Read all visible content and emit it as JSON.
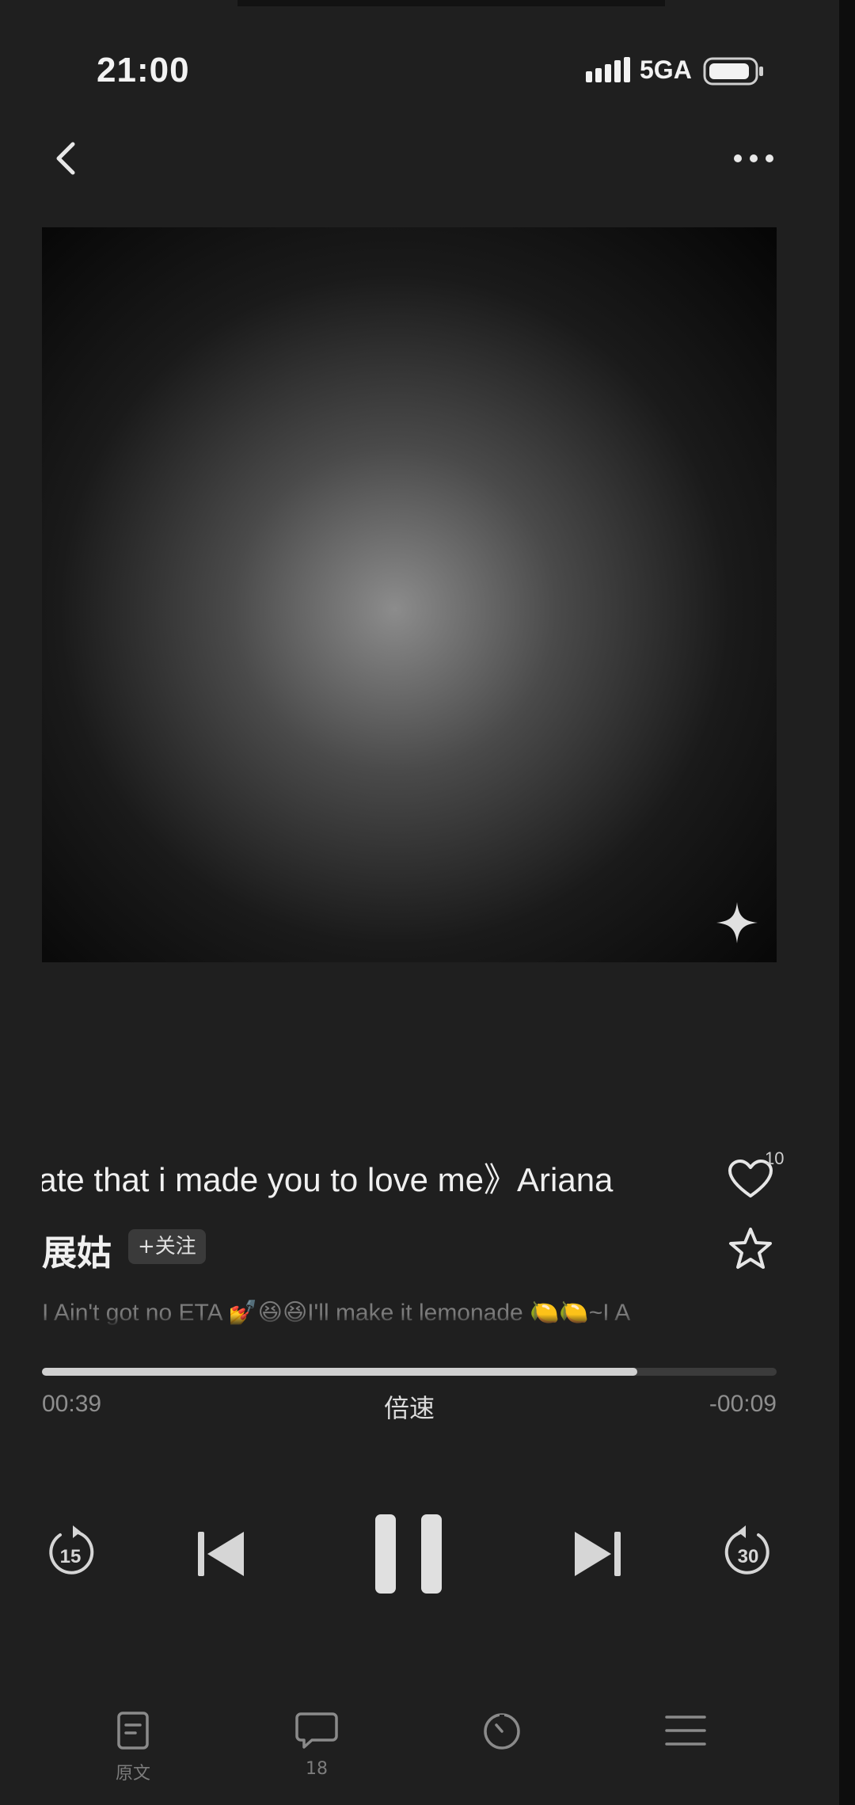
{
  "status_bar": {
    "time": "21:00",
    "network": "5GA",
    "icons": [
      "signal-icon",
      "battery-icon"
    ]
  },
  "nav": {
    "icons": [
      "chevron-left-icon",
      "more-icon"
    ]
  },
  "cover": {
    "icon": "sparkle-icon"
  },
  "track": {
    "title": "hate that i made you to love me》Ariana",
    "like_count": "10",
    "artist": "展姑",
    "follow_label": "+关注",
    "lyric": "I Ain't got no ETA 💅😆😆I'll make it lemonade 🍋🍋~I A"
  },
  "playback": {
    "elapsed": "00:39",
    "remaining": "-00:09",
    "speed_label": "倍速",
    "progress_fraction": 0.81
  },
  "controls": {
    "icons": [
      "rewind-15-icon",
      "previous-icon",
      "pause-icon",
      "next-icon",
      "forward-30-icon"
    ],
    "rewind_seconds": "15",
    "forward_seconds": "30"
  },
  "bottom_bar": {
    "tabs": [
      {
        "label": "原文",
        "icon": "document-icon"
      },
      {
        "label": "18",
        "icon": "comment-icon"
      },
      {
        "label": "",
        "icon": "timer-icon"
      },
      {
        "label": "",
        "icon": "list-icon"
      }
    ]
  },
  "colors": {
    "background": "#1f1f1f",
    "progress_fill": "#d0d0d0",
    "progress_track": "#3b3b3b"
  }
}
